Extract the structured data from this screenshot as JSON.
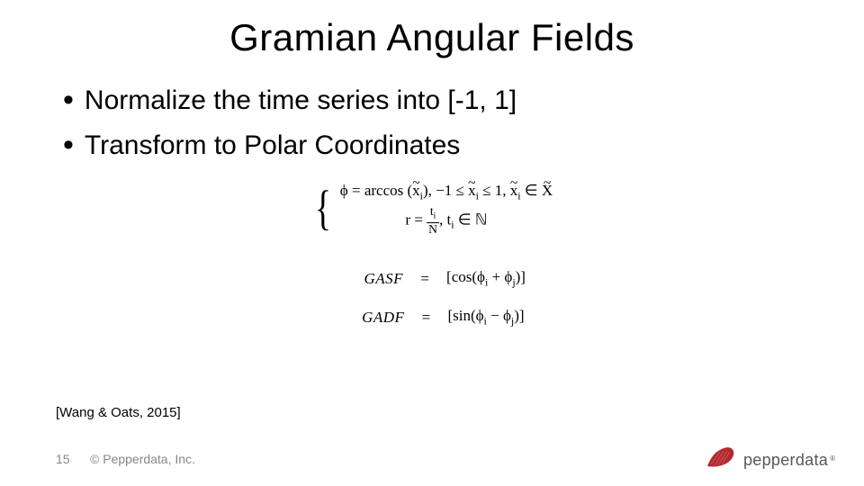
{
  "title": "Gramian Angular Fields",
  "bullets": {
    "b1": "Normalize the time series into [-1, 1]",
    "b2": "Transform to Polar Coordinates"
  },
  "formula": {
    "line1_prefix": "ϕ = arccos (",
    "line1_var": "x",
    "line1_sub": "i",
    "line1_mid1": "), −1 ≤ ",
    "line1_mid2": " ≤ 1, ",
    "line1_in": " ∈ ",
    "line1_set": "X",
    "line2_lhs": "r = ",
    "line2_num": "t",
    "line2_numsub": "i",
    "line2_den": "N",
    "line2_mid": ", t",
    "line2_sub": "i",
    "line2_tail": " ∈ ℕ"
  },
  "gasf": {
    "lhs": "GASF",
    "eq": "=",
    "rhs_open": "[cos(ϕ",
    "rhs_i": "i",
    "rhs_plus": " + ϕ",
    "rhs_j": "j",
    "rhs_close": ")]"
  },
  "gadf": {
    "lhs": "GADF",
    "eq": "=",
    "rhs_open": "[sin(ϕ",
    "rhs_i": "i",
    "rhs_minus": " − ϕ",
    "rhs_j": "j",
    "rhs_close": ")]"
  },
  "citation": "[Wang & Oats, 2015]",
  "page": "15",
  "copyright": "© Pepperdata, Inc.",
  "brand": {
    "name": "pepperdata",
    "tm": "®",
    "color": "#b3282d"
  }
}
